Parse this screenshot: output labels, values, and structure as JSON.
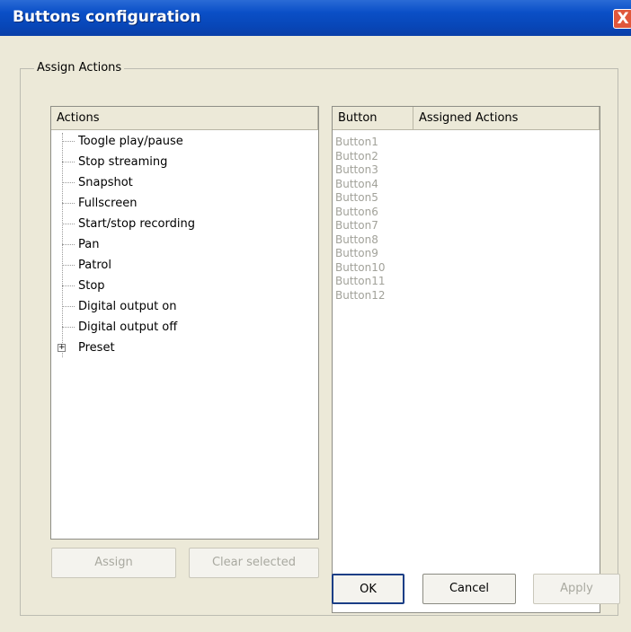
{
  "window": {
    "title": "Buttons configuration",
    "close_label": "X"
  },
  "group": {
    "legend": "Assign Actions"
  },
  "actions_panel": {
    "header": "Actions",
    "items": [
      "Toogle play/pause",
      "Stop streaming",
      "Snapshot",
      "Fullscreen",
      "Start/stop recording",
      "Pan",
      "Patrol",
      "Stop",
      "Digital output on",
      "Digital output off"
    ],
    "expandable_item": {
      "label": "Preset",
      "expander": "+"
    }
  },
  "buttons_panel": {
    "columns": [
      "Button",
      "Assigned Actions"
    ],
    "rows": [
      "Button1",
      "Button2",
      "Button3",
      "Button4",
      "Button5",
      "Button6",
      "Button7",
      "Button8",
      "Button9",
      "Button10",
      "Button11",
      "Button12"
    ]
  },
  "panel_buttons": {
    "assign": "Assign",
    "clear_selected": "Clear selected"
  },
  "footer_buttons": {
    "ok": "OK",
    "cancel": "Cancel",
    "apply": "Apply"
  }
}
